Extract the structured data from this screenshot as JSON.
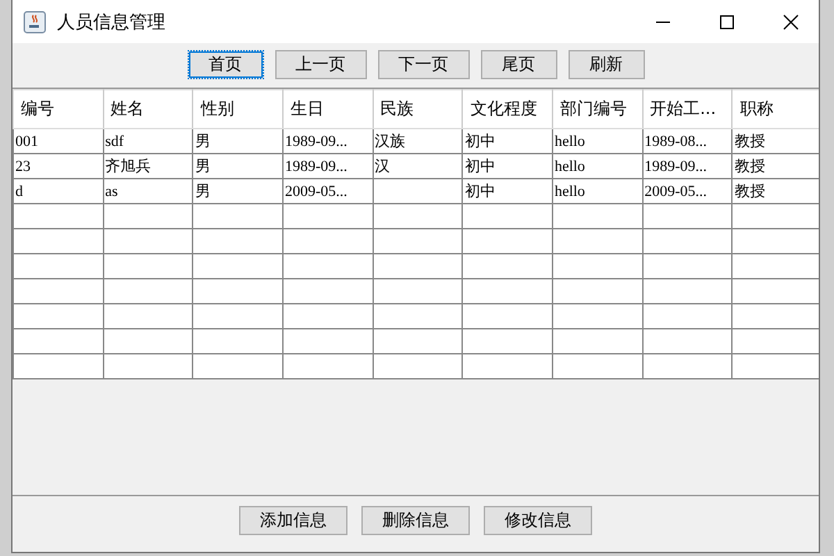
{
  "window": {
    "title": "人员信息管理"
  },
  "nav_buttons": [
    {
      "label": "首页",
      "selected": true
    },
    {
      "label": "上一页",
      "selected": false
    },
    {
      "label": "下一页",
      "selected": false
    },
    {
      "label": "尾页",
      "selected": false
    },
    {
      "label": "刷新",
      "selected": false
    }
  ],
  "table": {
    "columns": [
      "编号",
      "姓名",
      "性别",
      "生日",
      "民族",
      "文化程度",
      "部门编号",
      "开始工...",
      "职称"
    ],
    "rows": [
      [
        "001",
        "sdf",
        "男",
        "1989-09...",
        "汉族",
        "初中",
        "hello",
        "1989-08...",
        "教授"
      ],
      [
        "23",
        "齐旭兵",
        "男",
        "1989-09...",
        "汉",
        "初中",
        "hello",
        "1989-09...",
        "教授"
      ],
      [
        "d",
        "as",
        "男",
        "2009-05...",
        "",
        "初中",
        "hello",
        "2009-05...",
        "教授"
      ]
    ]
  },
  "action_buttons": [
    "添加信息",
    "删除信息",
    "修改信息"
  ]
}
